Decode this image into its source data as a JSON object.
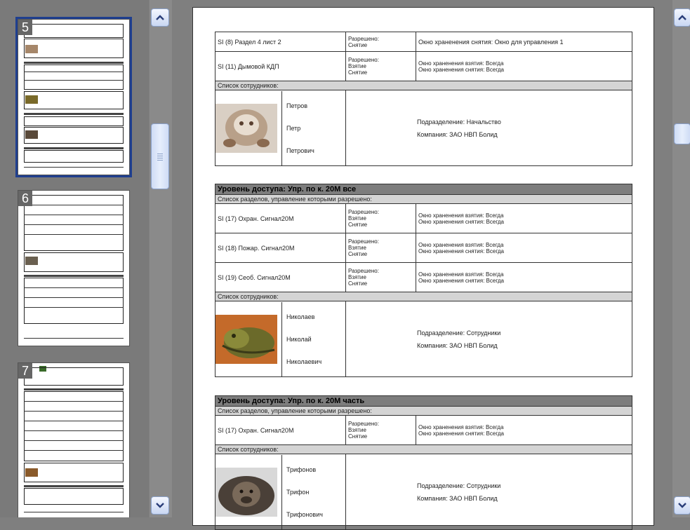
{
  "thumbnails": [
    {
      "number": "5",
      "selected": true
    },
    {
      "number": "6",
      "selected": false
    },
    {
      "number": "7",
      "selected": false
    }
  ],
  "scroll_icons": {
    "up": "chevron-up-icon",
    "down": "chevron-down-icon"
  },
  "block1": {
    "rows": [
      {
        "section": "SI (8) Раздел 4 лист 2",
        "rights": "Разрешено:\nСнятие",
        "windows": "Окно храненения снятия: Окно для управления 1"
      },
      {
        "section": "SI (11) Дымовой КДП",
        "rights": "Разрешено:\nВзятие\nСнятие",
        "windows": "Окно храненения взятия: Всегда\nОкно храненения снятия: Всегда"
      }
    ],
    "staff_label": "Список сотрудников:",
    "person": {
      "last": "Петров",
      "first": "Петр",
      "middle": "Петрович",
      "dept": "Подразделение: Начальство",
      "company": "Компания: ЗАО НВП Болид"
    }
  },
  "block2": {
    "title": "Уровень доступа: Упр. по к. 20М все",
    "sections_label": "Список разделов, управление которыми разрешено:",
    "rows": [
      {
        "section": "SI (17) Охран. Сигнал20М",
        "rights": "Разрешено:\nВзятие\nСнятие",
        "windows": "Окно храненения взятия: Всегда\nОкно храненения снятия: Всегда"
      },
      {
        "section": "SI (18) Пожар. Сигнал20М",
        "rights": "Разрешено:\nВзятие\nСнятие",
        "windows": "Окно храненения взятия: Всегда\nОкно храненения снятия: Всегда"
      },
      {
        "section": "SI (19) Сеоб. Сигнал20М",
        "rights": "Разрешено:\nВзятие\nСнятие",
        "windows": "Окно храненения взятия: Всегда\nОкно храненения снятия: Всегда"
      }
    ],
    "staff_label": "Список сотрудников:",
    "person": {
      "last": "Николаев",
      "first": "Николай",
      "middle": "Николаевич",
      "dept": "Подразделение: Сотрудники",
      "company": "Компания: ЗАО НВП Болид"
    }
  },
  "block3": {
    "title": "Уровень доступа: Упр. по к. 20М часть",
    "sections_label": "Список разделов, управление которыми разрешено:",
    "rows": [
      {
        "section": "SI (17) Охран. Сигнал20М",
        "rights": "Разрешено:\nВзятие\nСнятие",
        "windows": "Окно храненения взятия: Всегда\nОкно храненения снятия: Всегда"
      }
    ],
    "staff_label": "Список сотрудников:",
    "person": {
      "last": "Трифонов",
      "first": "Трифон",
      "middle": "Трифонович",
      "dept": "Подразделение: Сотрудники",
      "company": "Компания: ЗАО НВП Болид"
    }
  }
}
